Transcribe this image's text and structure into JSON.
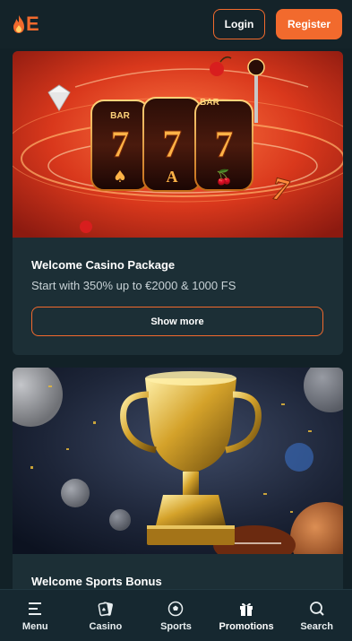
{
  "header": {
    "logo_letter": "E",
    "login_label": "Login",
    "register_label": "Register"
  },
  "promotions": [
    {
      "title": "Welcome Casino Package",
      "subtitle": "Start with 350% up to €2000 & 1000 FS",
      "button_label": "Show more",
      "image": "slot-machine-777"
    },
    {
      "title": "Welcome Sports Bonus",
      "image": "gold-trophy-balls"
    }
  ],
  "bottom_nav": [
    {
      "label": "Menu",
      "icon": "menu-icon"
    },
    {
      "label": "Casino",
      "icon": "casino-icon"
    },
    {
      "label": "Sports",
      "icon": "soccer-ball-icon"
    },
    {
      "label": "Promotions",
      "icon": "gift-icon"
    },
    {
      "label": "Search",
      "icon": "search-icon"
    }
  ],
  "colors": {
    "accent": "#f26a2d",
    "background": "#122127",
    "card": "#1c2f36"
  }
}
